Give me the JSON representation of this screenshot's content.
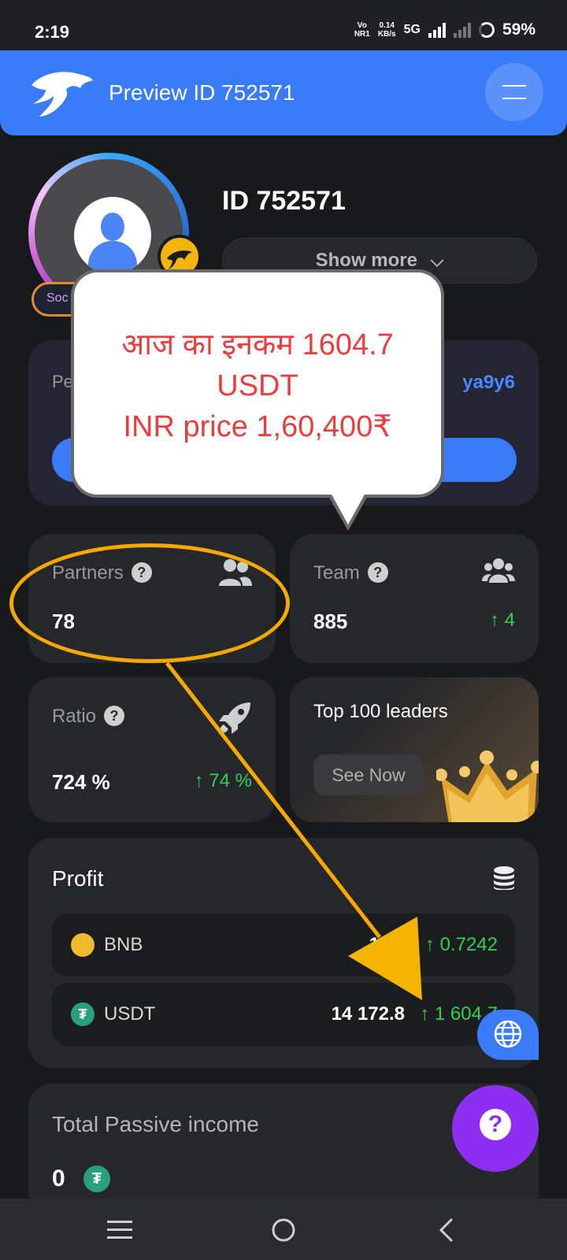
{
  "status_bar": {
    "time": "2:19",
    "volte": "Vo\nNR1",
    "net_speed": "0.14\nKB/s",
    "network": "5G",
    "battery": "59%"
  },
  "app_bar": {
    "title": "Preview ID  752571",
    "menu_icon": "hamburger-icon",
    "logo_icon": "panther-logo"
  },
  "profile": {
    "id_label": "ID 752571",
    "show_more": "Show more",
    "level_badge": "Soc",
    "avatar_icon": "user-icon"
  },
  "referral": {
    "label": "Pe",
    "code": "ya9y6"
  },
  "annotation": {
    "line1": "आज का इनकम 1604.7",
    "line2": "USDT",
    "line3": "INR price 1,60,400₹"
  },
  "stats": {
    "partners": {
      "label": "Partners",
      "value": "78",
      "icon": "users-icon"
    },
    "team": {
      "label": "Team",
      "value": "885",
      "delta": "↑ 4",
      "icon": "group-icon"
    },
    "ratio": {
      "label": "Ratio",
      "value": "724 %",
      "delta": "↑ 74 %",
      "icon": "rocket-icon"
    },
    "leaders": {
      "label": "Top 100 leaders",
      "button": "See Now",
      "icon": "crown-icon"
    }
  },
  "profit": {
    "title": "Profit",
    "icon": "coins-stack-icon",
    "rows": [
      {
        "coin": "BNB",
        "amount": "11.9",
        "change": "↑ 0.7242",
        "color": "#f3ba2f"
      },
      {
        "coin": "USDT",
        "amount": "14 172.8",
        "change": "↑ 1 604.7",
        "color": "#26a17b"
      }
    ]
  },
  "passive": {
    "title": "Total Passive income",
    "value": "0"
  },
  "fabs": {
    "globe": "globe-icon",
    "help": "?"
  },
  "colors": {
    "accent": "#3a7bfa",
    "positive": "#2ed158",
    "annotation": "#f5a900",
    "callout_text": "#ea3d3d"
  }
}
